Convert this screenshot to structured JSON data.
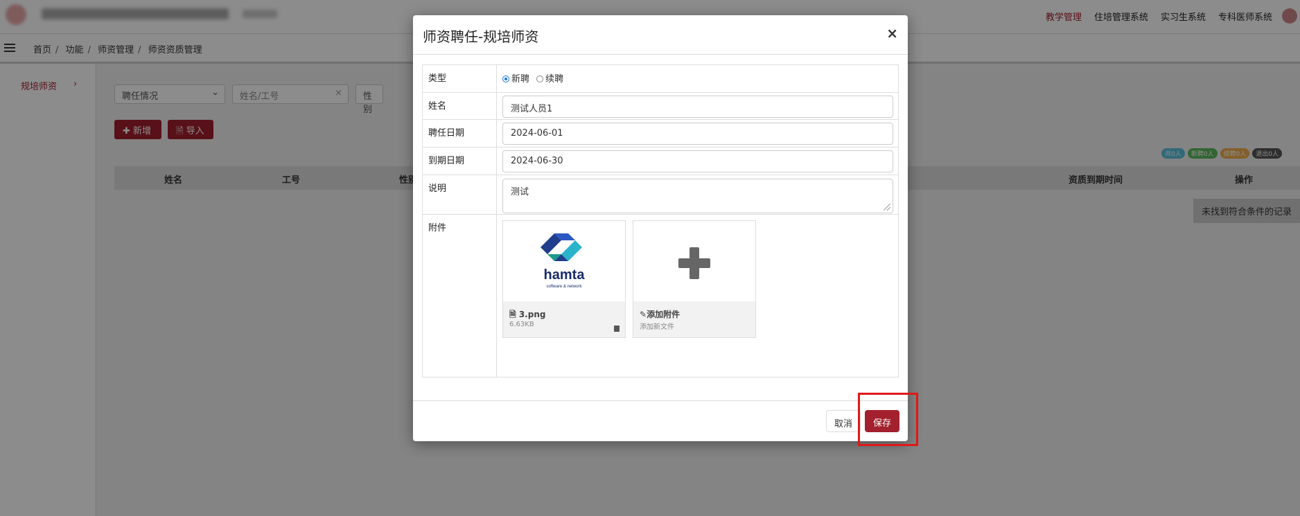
{
  "topbar": {
    "nav": [
      "教学管理",
      "住培管理系统",
      "实习生系统",
      "专科医师系统"
    ],
    "active_index": 0
  },
  "breadcrumb": [
    "首页",
    "功能",
    "师资管理",
    "师资资质管理"
  ],
  "sidebar": {
    "item": "规培师资",
    "arrow": "›"
  },
  "filters": {
    "status_select": "聘任情况",
    "status_arrow": "⌄",
    "name_placeholder": "姓名/工号",
    "clear": "×",
    "gender_select": "性别"
  },
  "actions": {
    "add": "新增",
    "import": "导入"
  },
  "badges": [
    {
      "text": "共0人",
      "color": "#5bc0de"
    },
    {
      "text": "新聘0人",
      "color": "#5cb85c"
    },
    {
      "text": "续聘0人",
      "color": "#f0ad4e"
    },
    {
      "text": "退出0人",
      "color": "#555555"
    }
  ],
  "table": {
    "headers": [
      "姓名",
      "工号",
      "性别",
      "资质到期时间",
      "操作"
    ],
    "empty": "未找到符合条件的记录"
  },
  "modal": {
    "title": "师资聘任-规培师资",
    "close": "×",
    "fields": {
      "type_label": "类型",
      "type_options": [
        "新聘",
        "续聘"
      ],
      "type_selected": 0,
      "name_label": "姓名",
      "name_value": "测试人员1",
      "start_label": "聘任日期",
      "start_value": "2024-06-01",
      "end_label": "到期日期",
      "end_value": "2024-06-30",
      "desc_label": "说明",
      "desc_value": "测试",
      "attach_label": "附件"
    },
    "attachment": {
      "filename": "3.png",
      "size": "6.63KB",
      "logo_text": "hamta",
      "logo_sub": "software & network"
    },
    "add_attachment": {
      "title": "添加附件",
      "hint": "添加新文件"
    },
    "buttons": {
      "cancel": "取消",
      "save": "保存"
    }
  },
  "colors": {
    "brand": "#a3202e",
    "highlight": "#e01818"
  }
}
